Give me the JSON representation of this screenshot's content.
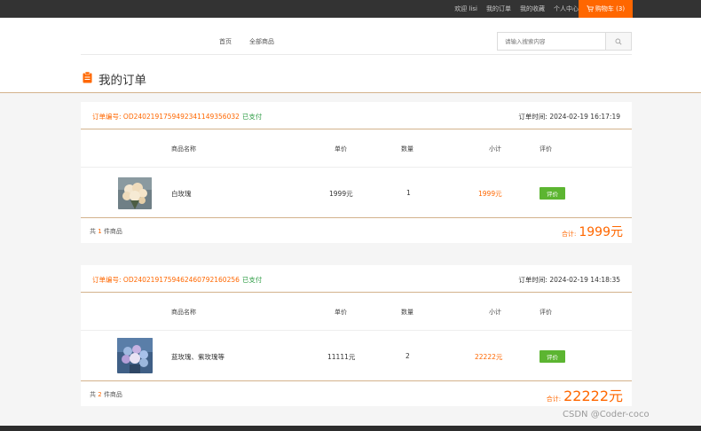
{
  "topbar": {
    "links": [
      "欢迎 lisi",
      "我的订单",
      "我的收藏",
      "个人中心"
    ],
    "cart_label": "购物车 (3)"
  },
  "header": {
    "nav": [
      "首页",
      "全部商品"
    ],
    "search_placeholder": "请输入搜索内容"
  },
  "page_title": "我的订单",
  "columns": {
    "name": "商品名称",
    "price": "单价",
    "qty": "数量",
    "subtotal": "小计",
    "review": "评价"
  },
  "orders": [
    {
      "id_text": "订单编号: OD2402191759492341149356032",
      "status": "已支付",
      "time_text": "订单时间: 2024-02-19 16:17:19",
      "item": {
        "name": "白玫瑰",
        "price": "1999元",
        "qty": "1",
        "subtotal": "1999元",
        "review_label": "评价"
      },
      "count_prefix": "共",
      "count": "1",
      "count_suffix": "件商品",
      "total_label": "合计:",
      "total": "1999元"
    },
    {
      "id_text": "订单编号: OD2402191759462460792160256",
      "status": "已支付",
      "time_text": "订单时间: 2024-02-19 14:18:35",
      "item": {
        "name": "蓝玫瑰、紫玫瑰等",
        "price": "11111元",
        "qty": "2",
        "subtotal": "22222元",
        "review_label": "评价"
      },
      "count_prefix": "共",
      "count": "2",
      "count_suffix": "件商品",
      "total_label": "合计:",
      "total": "22222元"
    }
  ],
  "watermark": "CSDN @Coder-coco",
  "colors": {
    "accent": "#ff6700",
    "paid": "#2f9d46",
    "review_button": "#5cb531",
    "divider": "#d3b28c"
  },
  "icons": {
    "cart": "cart-icon",
    "search": "search-icon",
    "title": "clipboard-icon"
  }
}
